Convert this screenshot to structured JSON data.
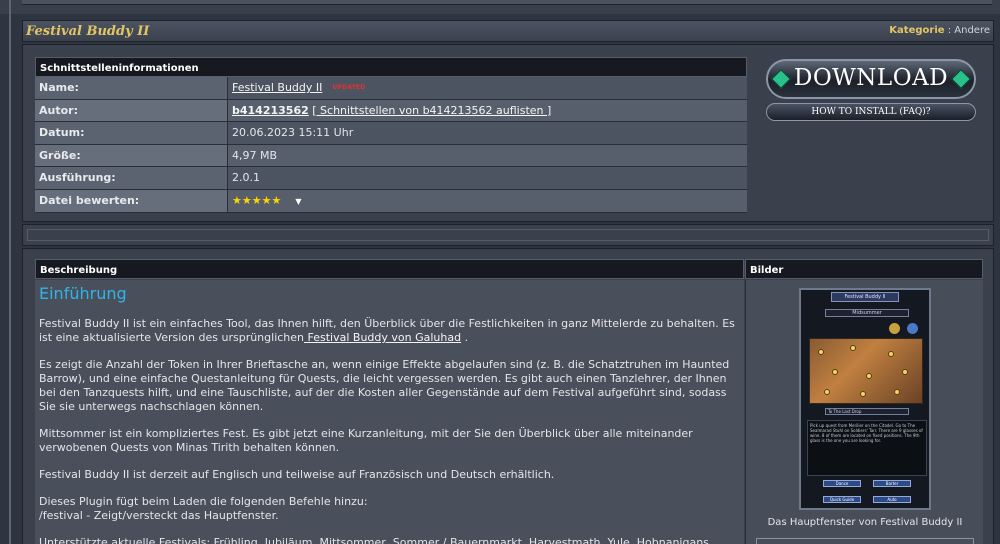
{
  "addon": {
    "title": "Festival Buddy II",
    "category_key": "Kategorie",
    "category_sep": " : ",
    "category_value": "Andere"
  },
  "info": {
    "header": "Schnittstelleninformationen",
    "rows": {
      "name": {
        "label": "Name:",
        "value": "Festival Buddy II",
        "badge": "UPDATED"
      },
      "author": {
        "label": "Autor:",
        "value": "b414213562",
        "link": "[ Schnittstellen von b414213562 auflisten ]"
      },
      "date": {
        "label": "Datum:",
        "value": "20.06.2023 15:11 Uhr"
      },
      "size": {
        "label": "Größe:",
        "value": "4,97 MB"
      },
      "version": {
        "label": "Ausführung:",
        "value": "2.0.1"
      },
      "rate": {
        "label": "Datei bewerten:",
        "value": "★★★★★"
      }
    }
  },
  "download": {
    "label": "Download",
    "howto": "How to install (FAQ)?"
  },
  "description": {
    "header": "Beschreibung",
    "heading": "Einführung",
    "p1_text": "Festival Buddy II ist ein einfaches Tool, das Ihnen hilft, den Überblick über die Festlichkeiten in ganz Mittelerde zu behalten. Es ist eine aktualisierte Version des ursprünglichen",
    "p1_link": " Festival Buddy von Galuhad",
    "p1_end": " .",
    "p2": "Es zeigt die Anzahl der Token in Ihrer Brieftasche an, wenn einige Effekte abgelaufen sind (z. B. die Schatztruhen im Haunted Barrow), und eine einfache Questanleitung für Quests, die leicht vergessen werden. Es gibt auch einen Tanzlehrer, der Ihnen bei den Tanzquests hilft, und eine Tauschliste, auf der die Kosten aller Gegenstände auf dem Festival aufgeführt sind, sodass Sie sie unterwegs nachschlagen können.",
    "p3": "Mittsommer ist ein kompliziertes Fest. Es gibt jetzt eine Kurzanleitung, mit der Sie den Überblick über alle miteinander verwobenen Quests von Minas Tirith behalten können.",
    "p4": "Festival Buddy II ist derzeit auf Englisch und teilweise auf Französisch und Deutsch erhältlich.",
    "p5_line1": "Dieses Plugin fügt beim Laden die folgenden Befehle hinzu:",
    "p5_line2": "/festival - Zeigt/versteckt das Hauptfenster.",
    "p6": "Unterstützte aktuelle Festivals: Frühling, Jubiläum, Mittsommer, Sommer / Bauernmarkt, Harvestmath, Yule, Hobnanigans"
  },
  "pictures": {
    "header": "Bilder",
    "caption": "Das Hauptfenster von Festival Buddy II",
    "screenshot": {
      "title": "Festival Buddy II",
      "select": "Midsummer",
      "quest": "To The Last Drop",
      "text": "Pick up quest from Merilier on the Citadel. Go to The Sealmarad Stuhl on Soldiers' Tarr. There are 9 glasses of wine. 8 of them are located on fixed positions. The 9th glass is the one you are looking for.",
      "btn_dance": "Dance",
      "btn_barter": "Barter",
      "btn_quick": "Quick Guide",
      "btn_auto": "Auto"
    }
  },
  "colors": {
    "accent_gold": "#e3c564",
    "heading_blue": "#30b4e8",
    "badge_red": "#e53030",
    "star_yellow": "#ffd400"
  }
}
